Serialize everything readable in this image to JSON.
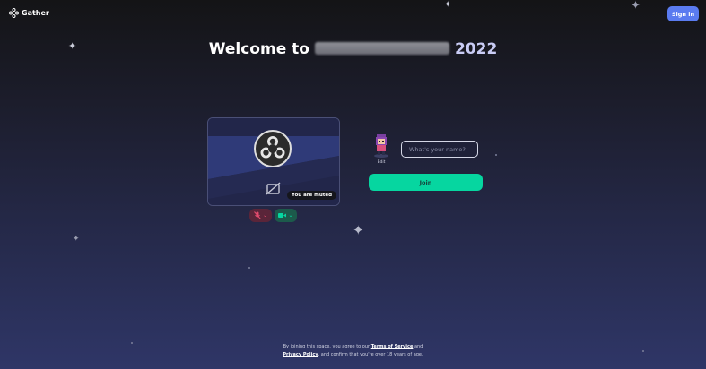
{
  "header": {
    "brand": "Gather",
    "signin_label": "Sign in"
  },
  "title": {
    "prefix": "Welcome to",
    "year": "2022"
  },
  "video": {
    "muted_label": "You are muted"
  },
  "avatar": {
    "label": "Edit"
  },
  "name_input": {
    "placeholder": "What's your name?",
    "value": ""
  },
  "join_label": "Join",
  "footer": {
    "line1_prefix": "By joining this space, you agree to our",
    "terms_link": "Terms of Service",
    "and": "and",
    "privacy_link": "Privacy Policy",
    "line2_suffix": ", and confirm that you're over 18 years of age."
  },
  "colors": {
    "accent_join": "#06d6a0",
    "signin_blue": "#5a7bf0",
    "mic_off_bg": "#5a2539",
    "camera_bg": "#1c5a4b"
  }
}
